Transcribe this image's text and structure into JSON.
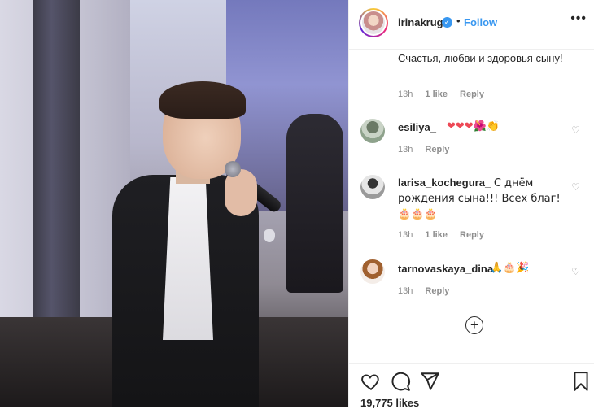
{
  "post": {
    "author": "irinakrug",
    "follow_label": "Follow",
    "dot": "•",
    "more": "•••",
    "caption_continuation": "Счастья, любви и здоровья сыну!",
    "caption_meta": {
      "time": "13h",
      "likes": "1 like",
      "reply": "Reply"
    },
    "likes_count": "19,775 likes"
  },
  "comments": [
    {
      "user": "esiliya_",
      "text": "❤❤❤🌺👏",
      "time": "13h",
      "likes": "",
      "reply": "Reply"
    },
    {
      "user": "larisa_kochegura_",
      "text": "С днём рождения сына!!! Всех благ!🎂🎂🎂",
      "time": "13h",
      "likes": "1 like",
      "reply": "Reply"
    },
    {
      "user": "tarnovaskaya_dina",
      "text": "🙏🎂🎉",
      "time": "13h",
      "likes": "",
      "reply": "Reply"
    }
  ],
  "icons": {
    "verified": "✓",
    "load_more": "+",
    "comment_heart": "♡"
  },
  "colors": {
    "accent": "#3897f0",
    "heart_red": "#ed4956",
    "meta_gray": "#8e8e8e"
  }
}
